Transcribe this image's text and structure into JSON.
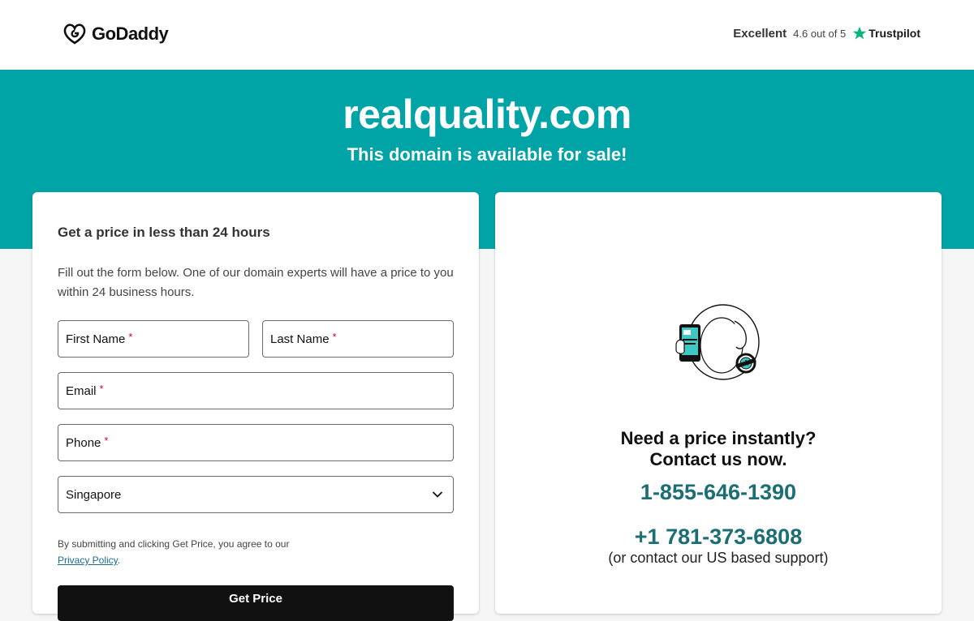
{
  "header": {
    "brand": "GoDaddy",
    "rating_word": "Excellent",
    "rating_score": "4.6 out of 5",
    "rating_source": "Trustpilot",
    "trustpilot_color": "#00b67a"
  },
  "hero": {
    "domain": "realquality.com",
    "tagline": "This domain is available for sale!",
    "background": "#00a4a6"
  },
  "form": {
    "title": "Get a price in less than 24 hours",
    "description": "Fill out the form below. One of our domain experts will have a price to you within 24 business hours.",
    "first_name_label": "First Name",
    "last_name_label": "Last Name",
    "email_label": "Email",
    "phone_label": "Phone",
    "required_marker": "*",
    "country_value": "Singapore",
    "terms_text": "By submitting and clicking Get Price, you agree to our",
    "privacy_link": "Privacy Policy",
    "terms_end": ".",
    "submit_label": "Get Price"
  },
  "contact": {
    "heading_line1": "Need a price instantly?",
    "heading_line2": "Contact us now.",
    "phone_primary": "1-855-646-1390",
    "phone_secondary": "+1 781-373-6808",
    "support_note": "(or contact our US based support)",
    "phone_color": "#1b6f74"
  }
}
